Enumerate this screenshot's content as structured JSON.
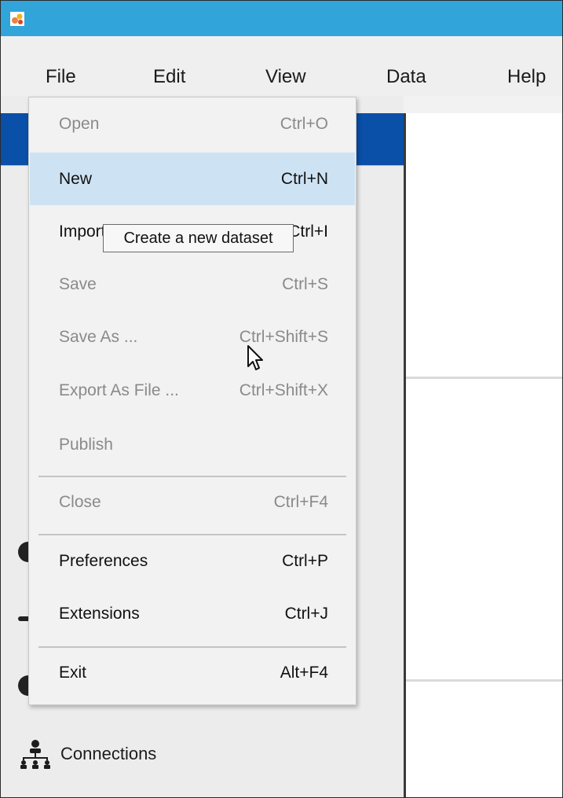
{
  "menubar": {
    "items": [
      "File",
      "Edit",
      "View",
      "Data",
      "Help"
    ]
  },
  "file_menu": {
    "items": [
      {
        "label": "Open",
        "shortcut": "Ctrl+O",
        "enabled": false
      },
      {
        "label": "New",
        "shortcut": "Ctrl+N",
        "enabled": true,
        "highlighted": true
      },
      {
        "label": "Import",
        "shortcut": "Ctrl+I",
        "enabled": true
      },
      {
        "label": "Save",
        "shortcut": "Ctrl+S",
        "enabled": false
      },
      {
        "label": "Save As ...",
        "shortcut": "Ctrl+Shift+S",
        "enabled": false
      },
      {
        "label": "Export As File ...",
        "shortcut": "Ctrl+Shift+X",
        "enabled": false
      },
      {
        "label": "Publish",
        "shortcut": "",
        "enabled": false
      },
      {
        "label": "Close",
        "shortcut": "Ctrl+F4",
        "enabled": false
      },
      {
        "label": "Preferences",
        "shortcut": "Ctrl+P",
        "enabled": true
      },
      {
        "label": "Extensions",
        "shortcut": "Ctrl+J",
        "enabled": true
      },
      {
        "label": "Exit",
        "shortcut": "Alt+F4",
        "enabled": true
      }
    ]
  },
  "tooltip": {
    "text": "Create a new dataset"
  },
  "sidebar": {
    "connections_label": "Connections"
  },
  "colors": {
    "titlebar": "#31a4da",
    "selection": "#0a4fa8",
    "menu_highlight": "#cde3f4"
  }
}
